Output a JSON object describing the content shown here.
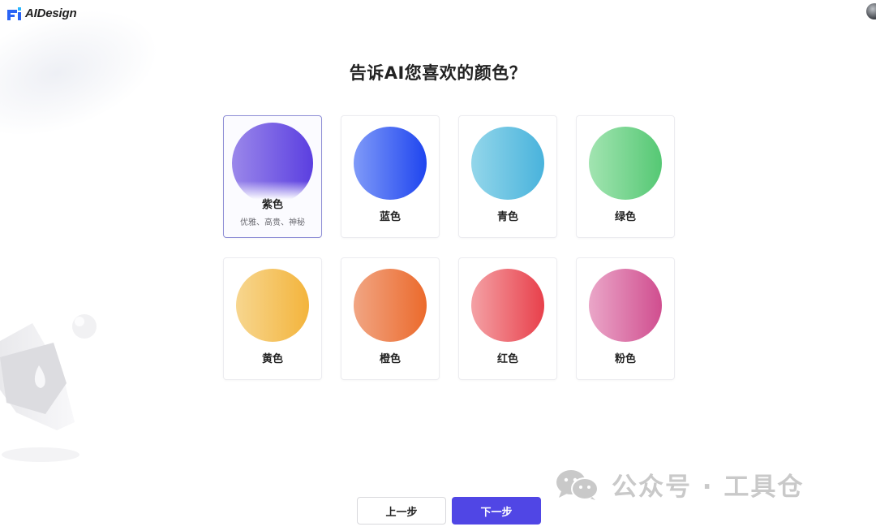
{
  "app": {
    "name": "AIDesign"
  },
  "page": {
    "title": "告诉AI您喜欢的颜色？"
  },
  "colors": [
    {
      "label": "紫色",
      "desc": "优雅、高贵、神秘",
      "from": "#9a87ea",
      "to": "#5b3fe0",
      "selected": true
    },
    {
      "label": "蓝色",
      "desc": "",
      "from": "#7f9af8",
      "to": "#1f45ef",
      "selected": false
    },
    {
      "label": "青色",
      "desc": "",
      "from": "#93d6ea",
      "to": "#49b3dc",
      "selected": false
    },
    {
      "label": "绿色",
      "desc": "",
      "from": "#a2e4b1",
      "to": "#55c874",
      "selected": false
    },
    {
      "label": "黄色",
      "desc": "",
      "from": "#f7d68f",
      "to": "#f3b43c",
      "selected": false
    },
    {
      "label": "橙色",
      "desc": "",
      "from": "#f1a583",
      "to": "#eb6a2c",
      "selected": false
    },
    {
      "label": "红色",
      "desc": "",
      "from": "#f4a1a5",
      "to": "#e8404b",
      "selected": false
    },
    {
      "label": "粉色",
      "desc": "",
      "from": "#eaa6c8",
      "to": "#d04e8f",
      "selected": false
    }
  ],
  "buttons": {
    "prev": "上一步",
    "next": "下一步"
  },
  "watermark": {
    "text": "公众号 · 工具仓"
  },
  "theme": {
    "accent": "#5046e5",
    "selected_border": "#8f8fd6"
  },
  "icons": {
    "logo": "aidesign-logo-icon",
    "watermark": "wechat-icon",
    "avatar": "user-avatar"
  }
}
